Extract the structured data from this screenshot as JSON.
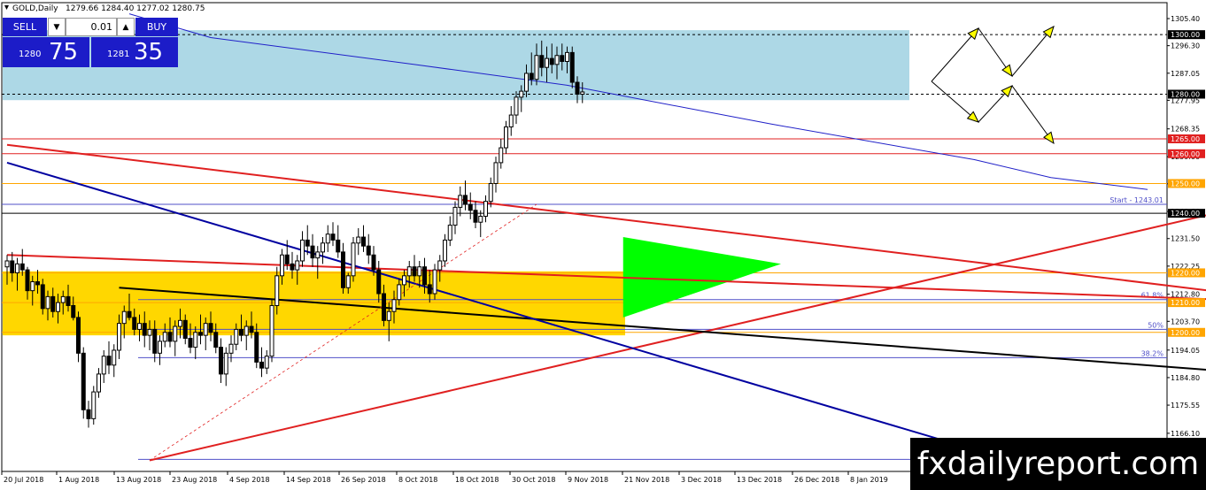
{
  "header": {
    "symbol": "GOLD,Daily",
    "ohlc": "1279.66 1284.40 1277.02 1280.75"
  },
  "trade_panel": {
    "sell_label": "SELL",
    "buy_label": "BUY",
    "lot_value": "0.01",
    "sell_price_small": "1280",
    "sell_price_big": "75",
    "buy_price_small": "1281",
    "buy_price_big": "35",
    "colors": {
      "panel_bg": "#1c1cc8",
      "text": "#ffffff"
    }
  },
  "watermark": "fxdailyreport.com",
  "chart_data": {
    "type": "candlestick",
    "symbol": "GOLD",
    "timeframe": "Daily",
    "y_ticks": [
      "1305.40",
      "1296.30",
      "1287.05",
      "1277.95",
      "1268.35",
      "1259.00",
      "1249.90",
      "1240.60",
      "1231.50",
      "1222.25",
      "1212.80",
      "1203.70",
      "1194.05",
      "1184.80",
      "1175.55",
      "1166.10",
      "1156.85"
    ],
    "y_range": [
      1156.85,
      1305.4
    ],
    "x_ticks": [
      "20 Jul 2018",
      "1 Aug 2018",
      "13 Aug 2018",
      "23 Aug 2018",
      "4 Sep 2018",
      "14 Sep 2018",
      "26 Sep 2018",
      "8 Oct 2018",
      "18 Oct 2018",
      "30 Oct 2018",
      "9 Nov 2018",
      "21 Nov 2018",
      "3 Dec 2018",
      "13 Dec 2018",
      "26 Dec 2018",
      "8 Jan 2019"
    ],
    "price_tags": [
      {
        "label": "1300.00",
        "value": 1300,
        "color": "#000000"
      },
      {
        "label": "1280.00",
        "value": 1280,
        "color": "#000000"
      },
      {
        "label": "1265.00",
        "value": 1265,
        "color": "#e02020"
      },
      {
        "label": "1260.00",
        "value": 1260,
        "color": "#e02020"
      },
      {
        "label": "1250.00",
        "value": 1250,
        "color": "#ffa500"
      },
      {
        "label": "1240.00",
        "value": 1240,
        "color": "#000000"
      },
      {
        "label": "1220.00",
        "value": 1220,
        "color": "#ffa500"
      },
      {
        "label": "1210.00",
        "value": 1210,
        "color": "#ffa500"
      },
      {
        "label": "1200.00",
        "value": 1200,
        "color": "#ffa500"
      }
    ],
    "annotations": [
      {
        "text": "Start - 1243.01",
        "value": 1243.01
      },
      {
        "text": "61.8%",
        "value": 1211
      },
      {
        "text": "50%",
        "value": 1201
      },
      {
        "text": "38.2%",
        "value": 1191.5
      }
    ],
    "zones": [
      {
        "name": "resistance",
        "from": 1278,
        "to": 1301.5,
        "color": "#add8e6"
      },
      {
        "name": "support",
        "from": 1199,
        "to": 1220.5,
        "color": "#ffd700"
      }
    ],
    "candles": [
      [
        1222,
        1226,
        1216,
        1224
      ],
      [
        1224,
        1227,
        1217,
        1220
      ],
      [
        1220,
        1225,
        1214,
        1223
      ],
      [
        1223,
        1228,
        1219,
        1221
      ],
      [
        1221,
        1222,
        1211,
        1214
      ],
      [
        1214,
        1219,
        1209,
        1217
      ],
      [
        1217,
        1221,
        1213,
        1216
      ],
      [
        1216,
        1218,
        1206,
        1208
      ],
      [
        1208,
        1214,
        1204,
        1212
      ],
      [
        1212,
        1215,
        1205,
        1207
      ],
      [
        1207,
        1213,
        1203,
        1210
      ],
      [
        1210,
        1214,
        1206,
        1212
      ],
      [
        1212,
        1216,
        1207,
        1209
      ],
      [
        1209,
        1212,
        1204,
        1205
      ],
      [
        1205,
        1207,
        1190,
        1193
      ],
      [
        1193,
        1195,
        1171,
        1174
      ],
      [
        1174,
        1177,
        1168,
        1171
      ],
      [
        1171,
        1182,
        1169,
        1180
      ],
      [
        1180,
        1188,
        1178,
        1186
      ],
      [
        1186,
        1194,
        1183,
        1192
      ],
      [
        1192,
        1197,
        1186,
        1189
      ],
      [
        1189,
        1196,
        1185,
        1194
      ],
      [
        1194,
        1206,
        1191,
        1203
      ],
      [
        1203,
        1209,
        1198,
        1207
      ],
      [
        1207,
        1213,
        1204,
        1205
      ],
      [
        1205,
        1208,
        1199,
        1201
      ],
      [
        1201,
        1206,
        1197,
        1203
      ],
      [
        1203,
        1207,
        1195,
        1199
      ],
      [
        1199,
        1204,
        1194,
        1201
      ],
      [
        1201,
        1204,
        1190,
        1193
      ],
      [
        1193,
        1199,
        1189,
        1197
      ],
      [
        1197,
        1203,
        1195,
        1200
      ],
      [
        1200,
        1205,
        1195,
        1197
      ],
      [
        1197,
        1204,
        1192,
        1202
      ],
      [
        1202,
        1208,
        1198,
        1204
      ],
      [
        1204,
        1206,
        1196,
        1198
      ],
      [
        1198,
        1203,
        1193,
        1195
      ],
      [
        1195,
        1202,
        1191,
        1200
      ],
      [
        1200,
        1206,
        1196,
        1199
      ],
      [
        1199,
        1205,
        1194,
        1203
      ],
      [
        1203,
        1207,
        1197,
        1200
      ],
      [
        1200,
        1203,
        1193,
        1195
      ],
      [
        1195,
        1198,
        1183,
        1186
      ],
      [
        1186,
        1195,
        1182,
        1193
      ],
      [
        1193,
        1199,
        1190,
        1196
      ],
      [
        1196,
        1203,
        1194,
        1201
      ],
      [
        1201,
        1206,
        1197,
        1199
      ],
      [
        1199,
        1204,
        1194,
        1202
      ],
      [
        1202,
        1207,
        1198,
        1200
      ],
      [
        1200,
        1203,
        1188,
        1190
      ],
      [
        1190,
        1195,
        1185,
        1188
      ],
      [
        1188,
        1194,
        1186,
        1192
      ],
      [
        1192,
        1211,
        1190,
        1209
      ],
      [
        1209,
        1222,
        1206,
        1219
      ],
      [
        1219,
        1228,
        1216,
        1226
      ],
      [
        1226,
        1231,
        1221,
        1223
      ],
      [
        1223,
        1227,
        1218,
        1221
      ],
      [
        1221,
        1226,
        1216,
        1224
      ],
      [
        1224,
        1234,
        1222,
        1231
      ],
      [
        1231,
        1236,
        1226,
        1229
      ],
      [
        1229,
        1233,
        1222,
        1225
      ],
      [
        1225,
        1229,
        1218,
        1227
      ],
      [
        1227,
        1232,
        1223,
        1230
      ],
      [
        1230,
        1236,
        1227,
        1233
      ],
      [
        1233,
        1237,
        1229,
        1231
      ],
      [
        1231,
        1236,
        1225,
        1227
      ],
      [
        1227,
        1230,
        1213,
        1215
      ],
      [
        1215,
        1220,
        1213,
        1219
      ],
      [
        1219,
        1232,
        1217,
        1230
      ],
      [
        1230,
        1235,
        1226,
        1232
      ],
      [
        1232,
        1236,
        1227,
        1229
      ],
      [
        1229,
        1233,
        1223,
        1226
      ],
      [
        1226,
        1229,
        1219,
        1221
      ],
      [
        1221,
        1224,
        1210,
        1213
      ],
      [
        1213,
        1216,
        1202,
        1204
      ],
      [
        1204,
        1210,
        1197,
        1207
      ],
      [
        1207,
        1214,
        1203,
        1211
      ],
      [
        1211,
        1218,
        1209,
        1216
      ],
      [
        1216,
        1221,
        1212,
        1219
      ],
      [
        1219,
        1224,
        1215,
        1222
      ],
      [
        1222,
        1226,
        1217,
        1219
      ],
      [
        1219,
        1224,
        1215,
        1222
      ],
      [
        1222,
        1225,
        1213,
        1216
      ],
      [
        1216,
        1221,
        1210,
        1213
      ],
      [
        1213,
        1223,
        1211,
        1221
      ],
      [
        1221,
        1226,
        1217,
        1224
      ],
      [
        1224,
        1233,
        1222,
        1231
      ],
      [
        1231,
        1239,
        1229,
        1236
      ],
      [
        1236,
        1244,
        1233,
        1242
      ],
      [
        1242,
        1249,
        1239,
        1246
      ],
      [
        1246,
        1251,
        1241,
        1243
      ],
      [
        1243,
        1247,
        1238,
        1241
      ],
      [
        1241,
        1244,
        1235,
        1237
      ],
      [
        1237,
        1241,
        1232,
        1239
      ],
      [
        1239,
        1246,
        1237,
        1244
      ],
      [
        1244,
        1252,
        1242,
        1250
      ],
      [
        1250,
        1259,
        1247,
        1257
      ],
      [
        1257,
        1265,
        1255,
        1262
      ],
      [
        1262,
        1271,
        1260,
        1269
      ],
      [
        1269,
        1276,
        1266,
        1273
      ],
      [
        1273,
        1281,
        1270,
        1279
      ],
      [
        1279,
        1283,
        1274,
        1281
      ],
      [
        1281,
        1290,
        1279,
        1287
      ],
      [
        1287,
        1294,
        1283,
        1285
      ],
      [
        1285,
        1297,
        1283,
        1293
      ],
      [
        1293,
        1298,
        1286,
        1289
      ],
      [
        1289,
        1296,
        1284,
        1292
      ],
      [
        1292,
        1297,
        1287,
        1290
      ],
      [
        1290,
        1296,
        1285,
        1293
      ],
      [
        1293,
        1297,
        1288,
        1291
      ],
      [
        1291,
        1296,
        1287,
        1294
      ],
      [
        1294,
        1296,
        1282,
        1284
      ],
      [
        1284,
        1286,
        1277,
        1280
      ],
      [
        1280,
        1284,
        1277,
        1280.75
      ]
    ],
    "moving_average": {
      "color": "#2020c8",
      "points": [
        [
          24,
          1307
        ],
        [
          40,
          1299
        ],
        [
          80,
          1290
        ],
        [
          110,
          1283
        ],
        [
          150,
          1270
        ],
        [
          190,
          1258
        ],
        [
          205,
          1252
        ],
        [
          224,
          1248
        ]
      ]
    },
    "trendlines": [
      {
        "color": "#e02020",
        "from": [
          0,
          1263
        ],
        "to": [
          270,
          1207
        ]
      },
      {
        "color": "#e02020",
        "from": [
          28,
          1157
        ],
        "to": [
          270,
          1253
        ]
      },
      {
        "color": "#e02020",
        "from": [
          0,
          1226
        ],
        "to": [
          270,
          1209
        ]
      },
      {
        "color": "#000000",
        "from": [
          22,
          1215
        ],
        "to": [
          270,
          1183
        ]
      },
      {
        "color": "#0000a0",
        "from": [
          0,
          1257
        ],
        "to": [
          205,
          1153
        ]
      },
      {
        "color": "#e02020",
        "dashed": true,
        "from": [
          28,
          1157
        ],
        "to": [
          104,
          1243
        ]
      }
    ]
  }
}
